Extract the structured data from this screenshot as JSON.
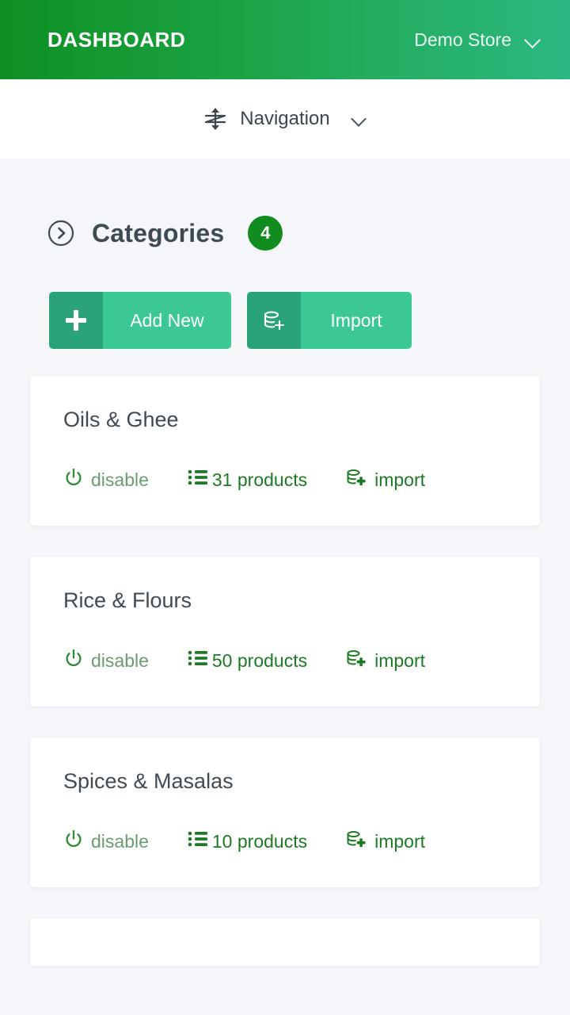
{
  "header": {
    "brand": "DASHBOARD",
    "store_name": "Demo Store",
    "store_chevron_icon": "chevron-down-icon",
    "gradient_from": "#0e9022",
    "gradient_to": "#2cb882"
  },
  "navbar": {
    "move_icon": "move-vertical-icon",
    "label": "Navigation",
    "chevron_icon": "chevron-down-icon"
  },
  "section": {
    "expand_icon": "circle-chevron-right-icon",
    "title": "Categories",
    "count": "4",
    "badge_color": "#118c1f"
  },
  "toolbar": {
    "add_new": {
      "icon": "plus-icon",
      "label": "Add New"
    },
    "import": {
      "icon": "database-plus-icon",
      "label": "Import"
    },
    "icon_bg": "#2aa379",
    "label_bg": "#3bc895"
  },
  "card_actions": {
    "disable_icon": "power-icon",
    "disable_label": "disable",
    "products_icon": "list-icon",
    "products_suffix": "products",
    "import_icon": "database-plus-icon",
    "import_label": "import"
  },
  "categories": [
    {
      "name": "Oils & Ghee",
      "disable_label": "disable",
      "product_count": "31 products",
      "import_label": "import"
    },
    {
      "name": "Rice & Flours",
      "disable_label": "disable",
      "product_count": "50 products",
      "import_label": "import"
    },
    {
      "name": "Spices & Masalas",
      "disable_label": "disable",
      "product_count": "10 products",
      "import_label": "import"
    }
  ],
  "page": {
    "background": "#f4f6f9"
  }
}
